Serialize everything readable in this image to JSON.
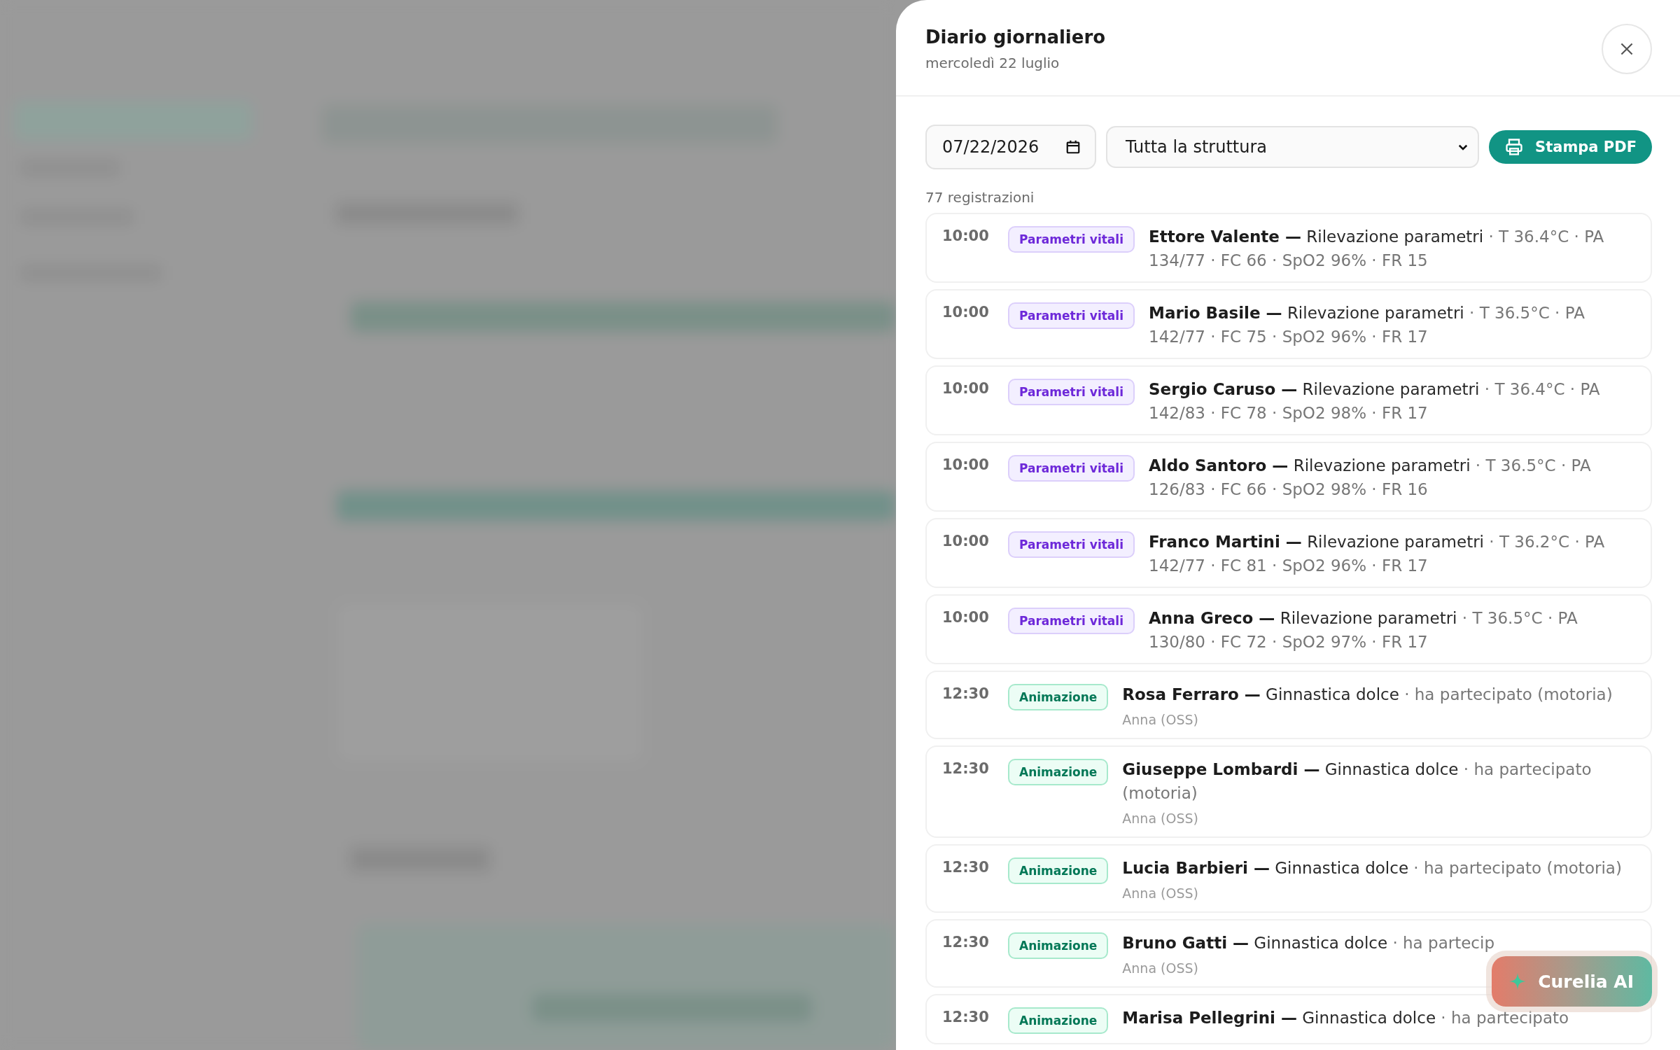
{
  "drawer": {
    "title": "Diario giornaliero",
    "subtitle": "mercoledì 22 luglio"
  },
  "filters": {
    "date": "07/22/2026",
    "scope": "Tutta la struttura",
    "print_button": "Stampa PDF"
  },
  "count": "77 registrazioni",
  "entries": [
    {
      "time": "10:00",
      "kind": "vitals",
      "category": "Parametri vitali",
      "resident": "Ettore Valente —",
      "activity": "Rilevazione parametri",
      "detail": "· T 36.4°C · PA 134/77 · FC 66 · SpO2 96% · FR 15"
    },
    {
      "time": "10:00",
      "kind": "vitals",
      "category": "Parametri vitali",
      "resident": "Mario Basile —",
      "activity": "Rilevazione parametri",
      "detail": "· T 36.5°C · PA 142/77 · FC 75 · SpO2 96% · FR 17"
    },
    {
      "time": "10:00",
      "kind": "vitals",
      "category": "Parametri vitali",
      "resident": "Sergio Caruso —",
      "activity": "Rilevazione parametri",
      "detail": "· T 36.4°C · PA 142/83 · FC 78 · SpO2 98% · FR 17"
    },
    {
      "time": "10:00",
      "kind": "vitals",
      "category": "Parametri vitali",
      "resident": "Aldo Santoro —",
      "activity": "Rilevazione parametri",
      "detail": "· T 36.5°C · PA 126/83 · FC 66 · SpO2 98% · FR 16"
    },
    {
      "time": "10:00",
      "kind": "vitals",
      "category": "Parametri vitali",
      "resident": "Franco Martini —",
      "activity": "Rilevazione parametri",
      "detail": "· T 36.2°C · PA 142/77 · FC 81 · SpO2 96% · FR 17"
    },
    {
      "time": "10:00",
      "kind": "vitals",
      "category": "Parametri vitali",
      "resident": "Anna Greco —",
      "activity": "Rilevazione parametri",
      "detail": "· T 36.5°C · PA 130/80 · FC 72 · SpO2 97% · FR 17"
    },
    {
      "time": "12:30",
      "kind": "animation",
      "category": "Animazione",
      "resident": "Rosa Ferraro —",
      "activity": "Ginnastica dolce",
      "detail": "· ha partecipato (motoria)",
      "author": "Anna (OSS)"
    },
    {
      "time": "12:30",
      "kind": "animation",
      "category": "Animazione",
      "resident": "Giuseppe Lombardi —",
      "activity": "Ginnastica dolce",
      "detail": "· ha partecipato (motoria)",
      "author": "Anna (OSS)"
    },
    {
      "time": "12:30",
      "kind": "animation",
      "category": "Animazione",
      "resident": "Lucia Barbieri —",
      "activity": "Ginnastica dolce",
      "detail": "· ha partecipato (motoria)",
      "author": "Anna (OSS)"
    },
    {
      "time": "12:30",
      "kind": "animation",
      "category": "Animazione",
      "resident": "Bruno Gatti —",
      "activity": "Ginnastica dolce",
      "detail": "· ha partecip",
      "author": "Anna (OSS)"
    },
    {
      "time": "12:30",
      "kind": "animation",
      "category": "Animazione",
      "resident": "Marisa Pellegrini —",
      "activity": "Ginnastica dolce",
      "detail": "· ha partecipato"
    }
  ],
  "assistant_button": "Curelia AI"
}
